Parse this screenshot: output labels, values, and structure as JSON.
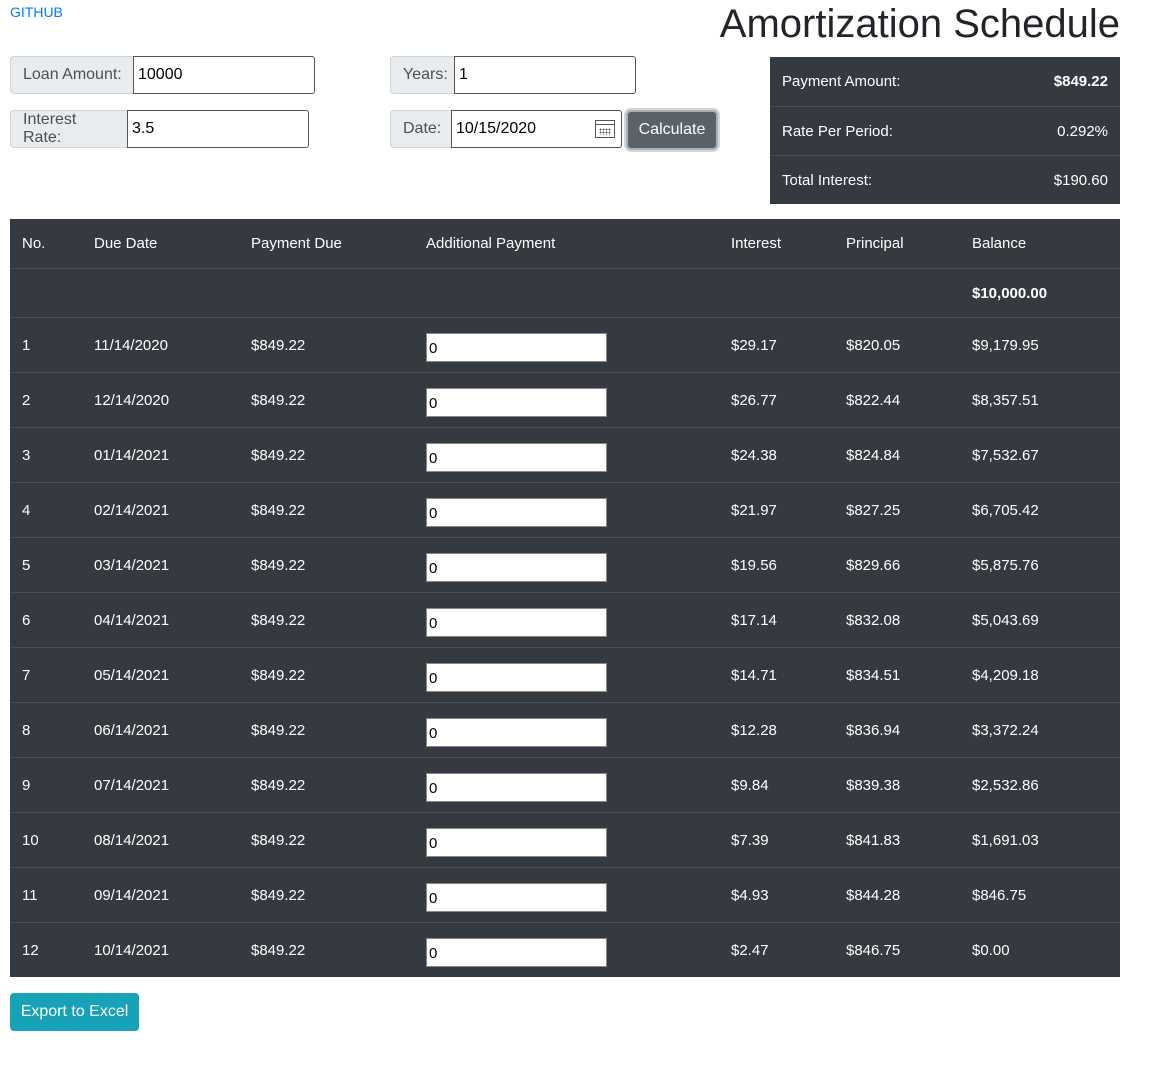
{
  "header": {
    "github_link": "GITHUB",
    "title": "Amortization Schedule"
  },
  "form": {
    "loan_amount": {
      "label": "Loan Amount:",
      "value": "10000"
    },
    "years": {
      "label": "Years:",
      "value": "1"
    },
    "interest_rate": {
      "label": "Interest Rate:",
      "value": "3.5"
    },
    "date": {
      "label": "Date:",
      "value": "10/15/2020"
    },
    "calculate_label": "Calculate"
  },
  "summary": [
    {
      "label": "Payment Amount:",
      "value": "$849.22"
    },
    {
      "label": "Rate Per Period:",
      "value": "0.292%"
    },
    {
      "label": "Total Interest:",
      "value": "$190.60"
    }
  ],
  "table": {
    "headers": [
      "No.",
      "Due Date",
      "Payment Due",
      "Additional Payment",
      "Interest",
      "Principal",
      "Balance"
    ],
    "opening_balance": "$10,000.00",
    "rows": [
      {
        "no": "1",
        "due_date": "11/14/2020",
        "payment": "$849.22",
        "additional": "0",
        "interest": "$29.17",
        "principal": "$820.05",
        "balance": "$9,179.95"
      },
      {
        "no": "2",
        "due_date": "12/14/2020",
        "payment": "$849.22",
        "additional": "0",
        "interest": "$26.77",
        "principal": "$822.44",
        "balance": "$8,357.51"
      },
      {
        "no": "3",
        "due_date": "01/14/2021",
        "payment": "$849.22",
        "additional": "0",
        "interest": "$24.38",
        "principal": "$824.84",
        "balance": "$7,532.67"
      },
      {
        "no": "4",
        "due_date": "02/14/2021",
        "payment": "$849.22",
        "additional": "0",
        "interest": "$21.97",
        "principal": "$827.25",
        "balance": "$6,705.42"
      },
      {
        "no": "5",
        "due_date": "03/14/2021",
        "payment": "$849.22",
        "additional": "0",
        "interest": "$19.56",
        "principal": "$829.66",
        "balance": "$5,875.76"
      },
      {
        "no": "6",
        "due_date": "04/14/2021",
        "payment": "$849.22",
        "additional": "0",
        "interest": "$17.14",
        "principal": "$832.08",
        "balance": "$5,043.69"
      },
      {
        "no": "7",
        "due_date": "05/14/2021",
        "payment": "$849.22",
        "additional": "0",
        "interest": "$14.71",
        "principal": "$834.51",
        "balance": "$4,209.18"
      },
      {
        "no": "8",
        "due_date": "06/14/2021",
        "payment": "$849.22",
        "additional": "0",
        "interest": "$12.28",
        "principal": "$836.94",
        "balance": "$3,372.24"
      },
      {
        "no": "9",
        "due_date": "07/14/2021",
        "payment": "$849.22",
        "additional": "0",
        "interest": "$9.84",
        "principal": "$839.38",
        "balance": "$2,532.86"
      },
      {
        "no": "10",
        "due_date": "08/14/2021",
        "payment": "$849.22",
        "additional": "0",
        "interest": "$7.39",
        "principal": "$841.83",
        "balance": "$1,691.03"
      },
      {
        "no": "11",
        "due_date": "09/14/2021",
        "payment": "$849.22",
        "additional": "0",
        "interest": "$4.93",
        "principal": "$844.28",
        "balance": "$846.75"
      },
      {
        "no": "12",
        "due_date": "10/14/2021",
        "payment": "$849.22",
        "additional": "0",
        "interest": "$2.47",
        "principal": "$846.75",
        "balance": "$0.00"
      }
    ]
  },
  "export_label": "Export to Excel",
  "icons": {
    "date_picker": "calendar-icon"
  },
  "colors": {
    "table_bg": "#343a40",
    "link": "#007bff",
    "export_button": "#17a2b8",
    "calculate_button": "#5a6268"
  }
}
